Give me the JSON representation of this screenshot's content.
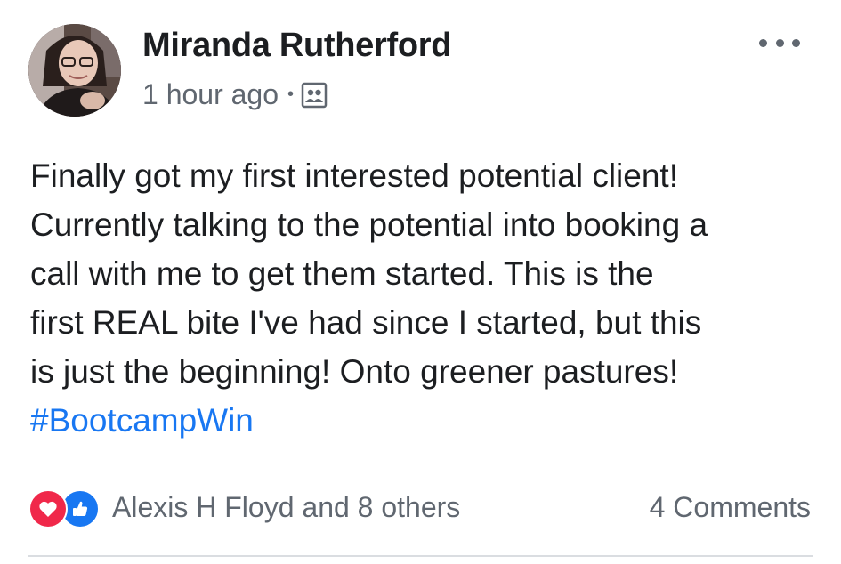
{
  "post": {
    "author": "Miranda Rutherford",
    "timestamp": "1 hour ago",
    "separator": "•",
    "audience_icon": "group-audience-icon",
    "text_lines": [
      "Finally got my first interested potential client!",
      "Currently talking to the potential into booking a",
      "call with me to get them started. This is the",
      "first REAL bite I've had since I started, but this",
      "is just the beginning! Onto greener pastures!"
    ],
    "hashtag": "#BootcampWin"
  },
  "footer": {
    "reaction_icons": [
      "love-reaction-icon",
      "like-reaction-icon"
    ],
    "reaction_summary": "Alexis H Floyd and 8 others",
    "comments_label": "4 Comments"
  },
  "colors": {
    "text": "#1c1e21",
    "secondary": "#606770",
    "link": "#1877f2",
    "love": "#f0284a",
    "like": "#1877f2"
  }
}
